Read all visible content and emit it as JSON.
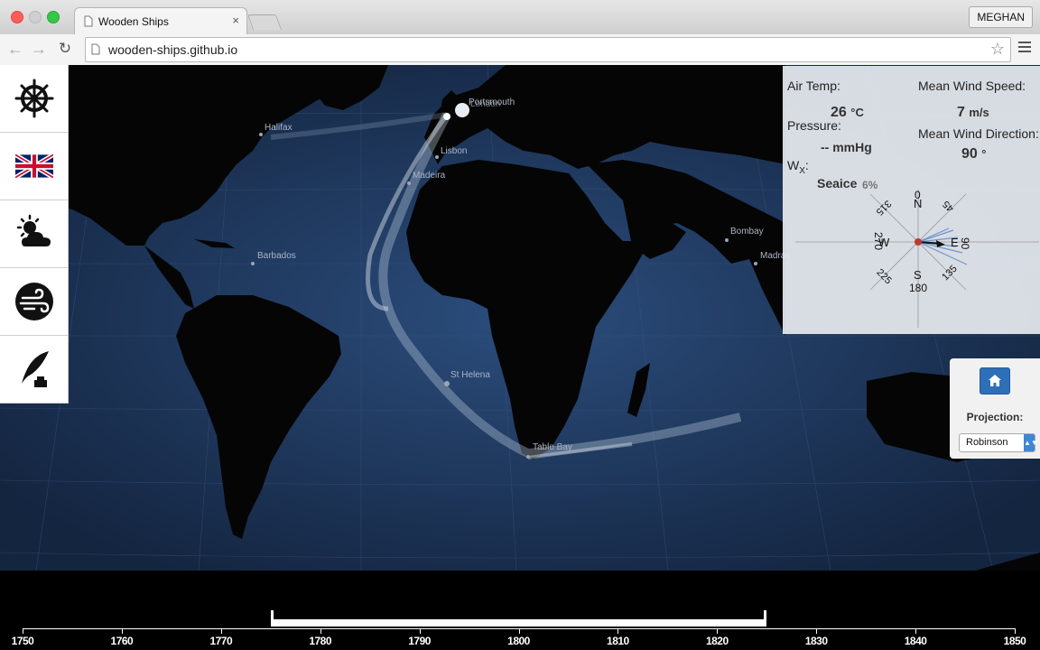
{
  "browser": {
    "tab_title": "Wooden Ships",
    "tab_close": "×",
    "url": "wooden-ships.github.io",
    "user": "MEGHAN",
    "back": "←",
    "forward": "→",
    "reload": "↻",
    "star": "☆"
  },
  "left_panel": {
    "items": [
      {
        "name": "ship-wheel-icon"
      },
      {
        "name": "uk-flag-icon"
      },
      {
        "name": "weather-icon"
      },
      {
        "name": "wind-icon"
      },
      {
        "name": "quill-ink-icon"
      }
    ]
  },
  "map": {
    "cities": [
      {
        "label": "Halifax"
      },
      {
        "label": "Lisbon"
      },
      {
        "label": "Madeira"
      },
      {
        "label": "Barbados"
      },
      {
        "label": "St Helena"
      },
      {
        "label": "Table Bay"
      },
      {
        "label": "Bombay"
      },
      {
        "label": "Madras"
      },
      {
        "label": "Portsmouth"
      },
      {
        "label": "London"
      }
    ]
  },
  "weather": {
    "air_temp_label": "Air Temp:",
    "air_temp_value": "26",
    "air_temp_unit": "°C",
    "pressure_label": "Pressure:",
    "pressure_value": "-- mmHg",
    "wx_label": "W",
    "wx_sub": "X",
    "wx_colon": ":",
    "seaice_label": "Seaice",
    "seaice_value": "6%",
    "wind_speed_label": "Mean Wind Speed:",
    "wind_speed_value": "7",
    "wind_speed_unit": "m/s",
    "wind_dir_label": "Mean Wind Direction:",
    "wind_dir_value": "90",
    "wind_dir_unit": "°",
    "compass": {
      "n": "N",
      "s": "S",
      "e": "E",
      "w": "W",
      "d0": "0",
      "d45": "45",
      "d90": "90",
      "d135": "135",
      "d180": "180",
      "d225": "225",
      "d270": "270",
      "d315": "315"
    }
  },
  "projection": {
    "label": "Projection:",
    "selected": "Robinson"
  },
  "timeline": {
    "ticks": [
      "1750",
      "1760",
      "1770",
      "1780",
      "1790",
      "1800",
      "1810",
      "1820",
      "1830",
      "1840",
      "1850"
    ],
    "brush_start": 1775,
    "brush_end": 1825
  }
}
